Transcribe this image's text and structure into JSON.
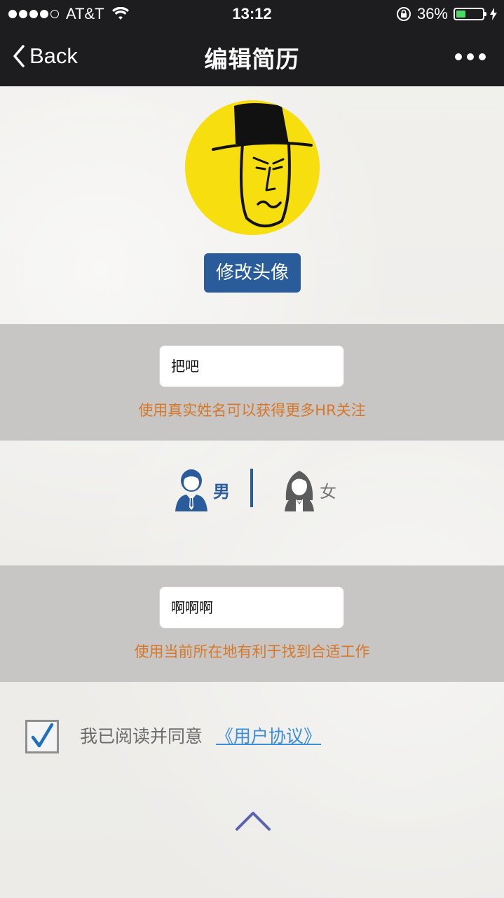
{
  "status_bar": {
    "carrier": "AT&T",
    "time": "13:12",
    "battery_percent": "36%",
    "battery_level": 0.36,
    "battery_color": "#4cd964"
  },
  "nav": {
    "back_label": "Back",
    "title": "编辑简历",
    "more_icon": "ellipsis-icon"
  },
  "avatar": {
    "button_label": "修改头像",
    "button_color": "#2a5c9c"
  },
  "name_field": {
    "value": "把吧",
    "hint": "使用真实姓名可以获得更多HR关注"
  },
  "gender": {
    "male_label": "男",
    "female_label": "女",
    "selected": "male",
    "selected_color": "#2a5c9c"
  },
  "location_field": {
    "value": "啊啊啊",
    "hint": "使用当前所在地有利于找到合适工作"
  },
  "agreement": {
    "checked": true,
    "text": "我已阅读并同意",
    "link_label": "《用户协议》",
    "link_color": "#3b8ed8"
  },
  "hint_color": "#d6772a"
}
